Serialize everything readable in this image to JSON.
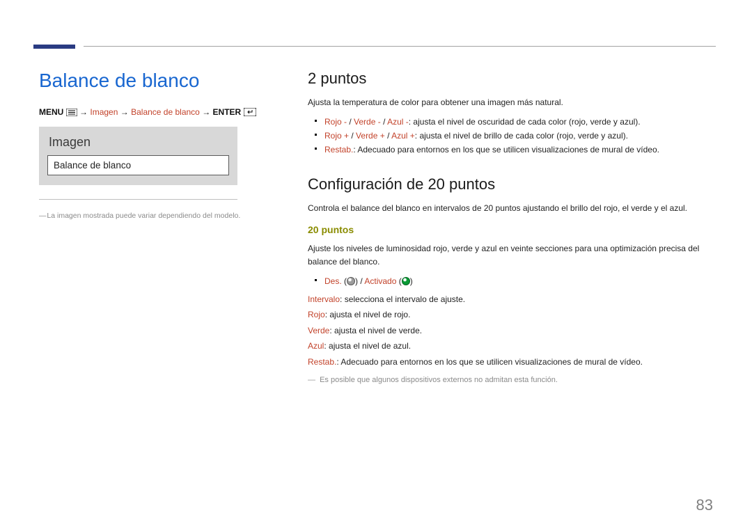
{
  "page_number": "83",
  "left": {
    "title": "Balance de blanco",
    "nav": {
      "menu_label": "MENU",
      "segments": [
        "Imagen",
        "Balance de blanco"
      ],
      "enter_label": "ENTER",
      "arrow": "→"
    },
    "panel": {
      "title": "Imagen",
      "row": "Balance de blanco"
    },
    "caption": "La imagen mostrada puede variar dependiendo del modelo."
  },
  "right": {
    "s1_heading": "2 puntos",
    "s1_intro": "Ajusta la temperatura de color para obtener una imagen más natural.",
    "s1_b1_a": "Rojo -",
    "s1_b1_b": "Verde -",
    "s1_b1_c": "Azul -",
    "s1_b1_rest": ": ajusta el nivel de oscuridad de cada color (rojo, verde y azul).",
    "s1_b2_a": "Rojo +",
    "s1_b2_b": "Verde +",
    "s1_b2_c": "Azul +",
    "s1_b2_rest": ": ajusta el nivel de brillo de cada color (rojo, verde y azul).",
    "s1_b3_a": "Restab.",
    "s1_b3_rest": ": Adecuado para entornos en los que se utilicen visualizaciones de mural de vídeo.",
    "s2_heading": "Configuración de 20 puntos",
    "s2_intro": "Controla el balance del blanco en intervalos de 20 puntos ajustando el brillo del rojo, el verde y el azul.",
    "s2_sub": "20 puntos",
    "s2_desc": "Ajuste los niveles de luminosidad rojo, verde y azul en veinte secciones para una optimización precisa del balance del blanco.",
    "toggle_off": "Des.",
    "toggle_on": "Activado",
    "slash": " / ",
    "colon_space": ": ",
    "paren_open": " (",
    "paren_close": ")",
    "kv": [
      {
        "k": "Intervalo",
        "v": "selecciona el intervalo de ajuste."
      },
      {
        "k": "Rojo",
        "v": "ajusta el nivel de rojo."
      },
      {
        "k": "Verde",
        "v": "ajusta el nivel de verde."
      },
      {
        "k": "Azul",
        "v": "ajusta el nivel de azul."
      },
      {
        "k": "Restab.",
        "v": "Adecuado para entornos en los que se utilicen visualizaciones de mural de vídeo."
      }
    ],
    "footnote": "Es posible que algunos dispositivos externos no admitan esta función."
  }
}
